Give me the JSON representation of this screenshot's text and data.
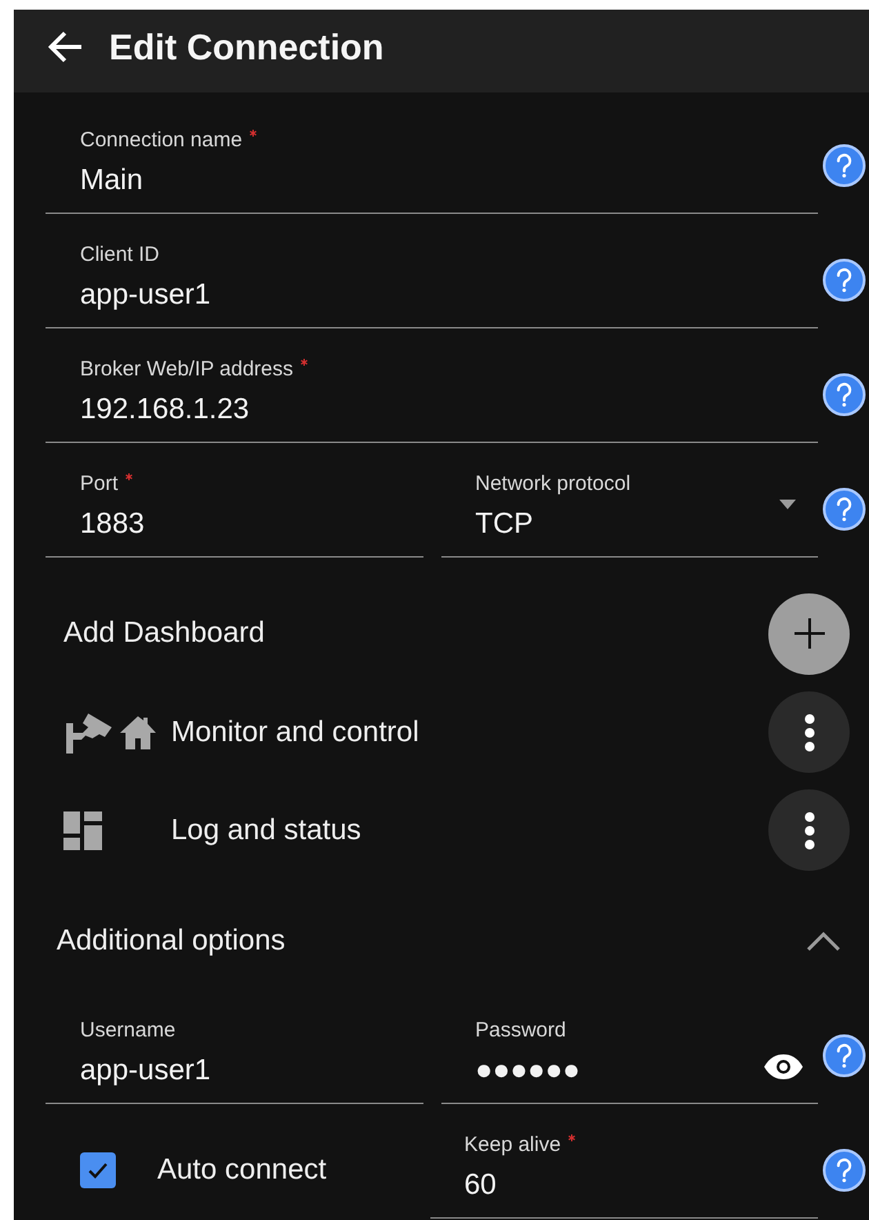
{
  "header": {
    "title": "Edit Connection"
  },
  "rows": [
    {
      "fields": [
        {
          "kind": "text",
          "label": "Connection name",
          "required": true,
          "value": "Main"
        }
      ]
    },
    {
      "fields": [
        {
          "kind": "text",
          "label": "Client ID",
          "required": false,
          "value": "app-user1"
        }
      ]
    },
    {
      "fields": [
        {
          "kind": "text",
          "label": "Broker Web/IP address",
          "required": true,
          "value": "192.168.1.23"
        }
      ]
    },
    {
      "fields": [
        {
          "kind": "text",
          "label": "Port",
          "required": true,
          "value": "1883"
        },
        {
          "kind": "select",
          "label": "Network protocol",
          "required": false,
          "value": "TCP"
        }
      ]
    }
  ],
  "dashboards": {
    "add_label": "Add Dashboard",
    "items": [
      {
        "kind": "camera-home",
        "label": "Monitor and control"
      },
      {
        "kind": "grid",
        "label": "Log and status"
      }
    ]
  },
  "additional": {
    "title": "Additional options",
    "expanded": true,
    "rows": [
      {
        "fields": [
          {
            "kind": "text",
            "label": "Username",
            "required": false,
            "value": "app-user1"
          },
          {
            "kind": "password",
            "label": "Password",
            "required": false,
            "value": "●●●●●●"
          }
        ]
      },
      {
        "fields": [
          {
            "kind": "checkbox",
            "label": "Auto connect",
            "checked": true
          },
          {
            "kind": "text",
            "label": "Keep alive",
            "required": true,
            "value": "60"
          }
        ]
      }
    ]
  }
}
